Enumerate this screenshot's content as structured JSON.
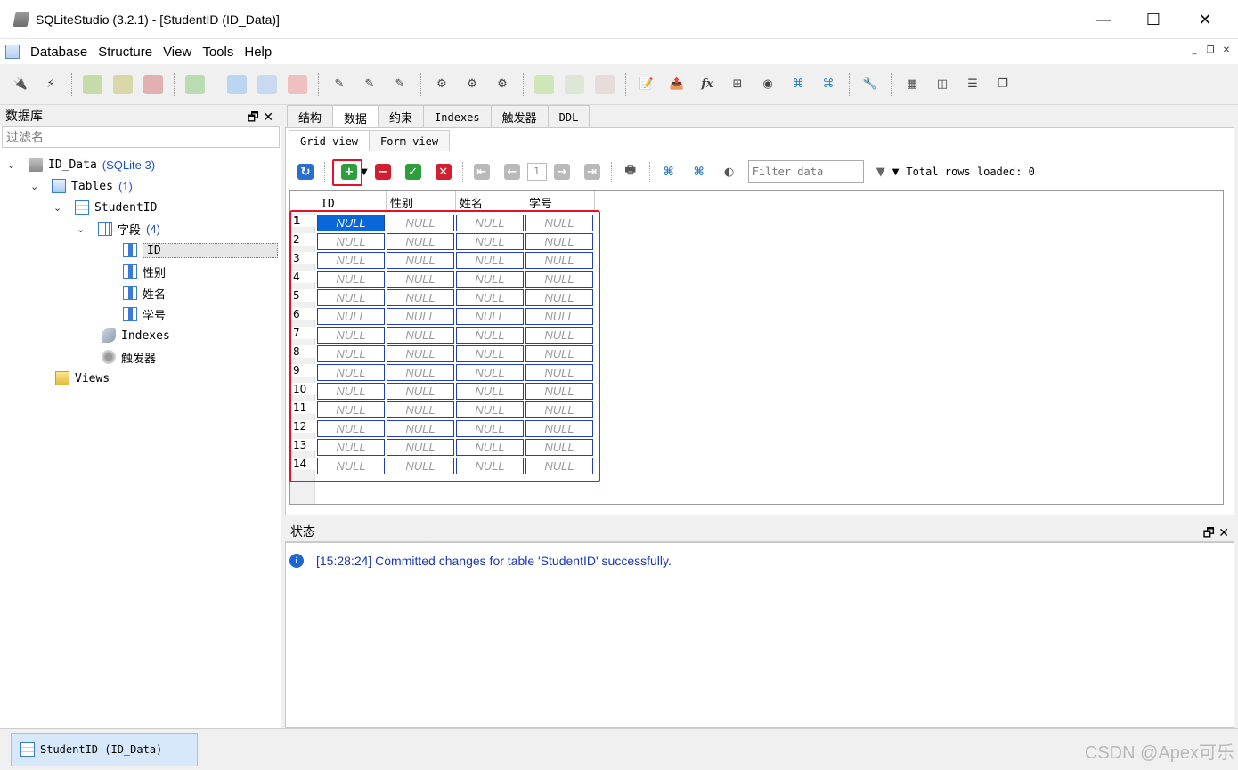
{
  "window": {
    "title": "SQLiteStudio (3.2.1) - [StudentID (ID_Data)]",
    "minimize": "—",
    "maximize": "☐",
    "close": "✕"
  },
  "menubar": {
    "items": [
      "Database",
      "Structure",
      "View",
      "Tools",
      "Help"
    ]
  },
  "leftpanel": {
    "title": "数据库",
    "filter_placeholder": "过滤名",
    "tree": {
      "db_name": "ID_Data",
      "db_type": "(SQLite 3)",
      "tables_label": "Tables",
      "tables_count": "(1)",
      "table_name": "StudentID",
      "fields_label": "字段",
      "fields_count": "(4)",
      "columns": [
        "ID",
        "性别",
        "姓名",
        "学号"
      ],
      "indexes_label": "Indexes",
      "triggers_label": "触发器",
      "views_label": "Views"
    }
  },
  "tabs": [
    "结构",
    "数据",
    "约束",
    "Indexes",
    "触发器",
    "DDL"
  ],
  "active_tab": "数据",
  "subtabs": [
    "Grid view",
    "Form view"
  ],
  "active_subtab": "Grid view",
  "gridtoolbar": {
    "page": "1",
    "filter_placeholder": "Filter data",
    "total_rows": "Total rows loaded: 0"
  },
  "grid": {
    "headers": [
      "ID",
      "性别",
      "姓名",
      "学号"
    ],
    "row_numbers": [
      "1",
      "2",
      "3",
      "4",
      "5",
      "6",
      "7",
      "8",
      "9",
      "10",
      "11",
      "12",
      "13",
      "14"
    ],
    "cell_value": "NULL"
  },
  "status": {
    "title": "状态",
    "message": "[15:28:24] Committed changes for table 'StudentID' successfully."
  },
  "taskbar": {
    "item": "StudentID (ID_Data)"
  },
  "watermark": "CSDN @Apex可乐",
  "colors": {
    "highlight_red": "#e3122a",
    "selection_blue": "#0a67d8",
    "status_text": "#1a37b4"
  }
}
